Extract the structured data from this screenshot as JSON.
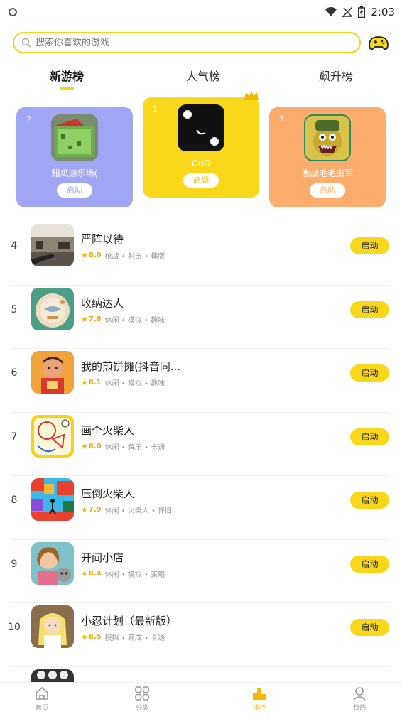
{
  "status": {
    "time": "2:03"
  },
  "search": {
    "placeholder": "搜索你喜欢的游戏"
  },
  "tabs": [
    {
      "label": "新游榜",
      "active": true
    },
    {
      "label": "人气榜",
      "active": false
    },
    {
      "label": "飙升榜",
      "active": false
    }
  ],
  "podium": [
    {
      "rank": "2",
      "name": "甜瓜游乐场(",
      "launch": "启动",
      "color": "#a0a5f4"
    },
    {
      "rank": "1",
      "name": "OuO",
      "launch": "启动",
      "color": "#f9d81b"
    },
    {
      "rank": "3",
      "name": "激战毛毛虫军",
      "launch": "启动",
      "color": "#fcad6e"
    }
  ],
  "list": [
    {
      "rank": "4",
      "title": "严阵以待",
      "score": "8.0",
      "tags": "枪战 • 射击 • 横版",
      "launch": "启动"
    },
    {
      "rank": "5",
      "title": "收纳达人",
      "score": "7.8",
      "tags": "休闲 • 模拟 • 趣味",
      "launch": "启动"
    },
    {
      "rank": "6",
      "title": "我的煎饼摊(抖音同...",
      "score": "8.1",
      "tags": "休闲 • 模拟 • 趣味",
      "launch": "启动"
    },
    {
      "rank": "7",
      "title": "画个火柴人",
      "score": "8.0",
      "tags": "休闲 • 解压 • 卡通",
      "launch": "启动"
    },
    {
      "rank": "8",
      "title": "压倒火柴人",
      "score": "7.9",
      "tags": "休闲 • 火柴人 • 怀旧",
      "launch": "启动"
    },
    {
      "rank": "9",
      "title": "开间小店",
      "score": "8.4",
      "tags": "休闲 • 模拟 • 策略",
      "launch": "启动"
    },
    {
      "rank": "10",
      "title": "小忍计划（最新版）",
      "score": "8.5",
      "tags": "模拟 • 养成 • 卡通",
      "launch": "启动"
    }
  ],
  "nav": [
    {
      "label": "首页",
      "icon": "home-icon"
    },
    {
      "label": "分类",
      "icon": "grid-icon"
    },
    {
      "label": "排行",
      "icon": "ranking-icon",
      "active": true
    },
    {
      "label": "我的",
      "icon": "profile-icon"
    }
  ],
  "colors": {
    "accent": "#f9d81b",
    "search_border": "#f6d417",
    "score": "#f5a800"
  }
}
